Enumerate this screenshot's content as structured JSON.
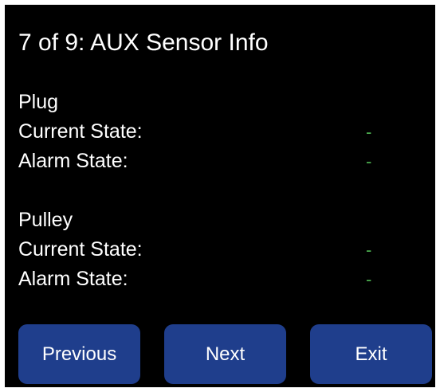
{
  "header": {
    "title": "7 of 9: AUX Sensor Info"
  },
  "sensors": [
    {
      "name": "Plug",
      "current_state_label": "Current State:",
      "current_state_value": "-",
      "alarm_state_label": "Alarm State:",
      "alarm_state_value": "-"
    },
    {
      "name": "Pulley",
      "current_state_label": "Current State:",
      "current_state_value": "-",
      "alarm_state_label": "Alarm State:",
      "alarm_state_value": "-"
    }
  ],
  "buttons": {
    "previous": "Previous",
    "next": "Next",
    "exit": "Exit"
  },
  "colors": {
    "background": "#000000",
    "text": "#ffffff",
    "value": "#4caf50",
    "button": "#1f3e8c"
  }
}
